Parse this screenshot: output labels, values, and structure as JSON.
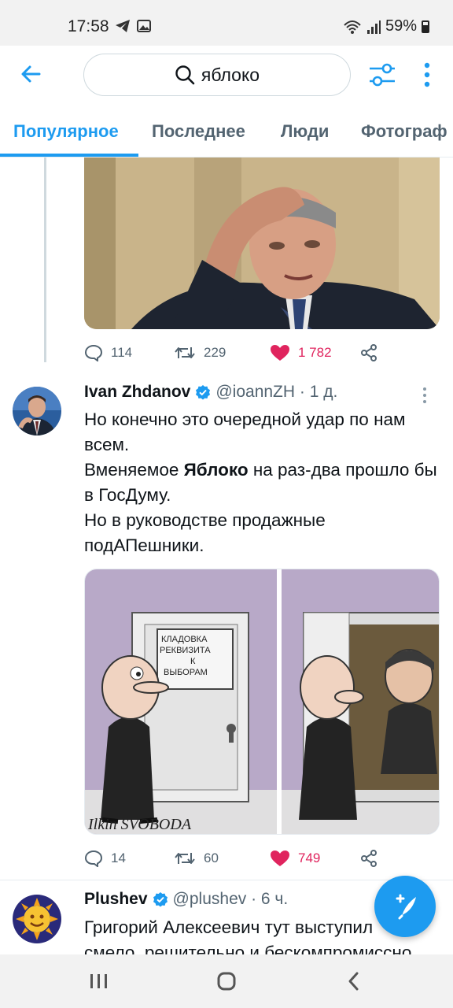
{
  "status_bar": {
    "time": "17:58",
    "battery": "59%"
  },
  "header": {
    "search_value": "яблоко"
  },
  "tabs": [
    {
      "label": "Популярное",
      "active": true
    },
    {
      "label": "Последнее"
    },
    {
      "label": "Люди"
    },
    {
      "label": "Фотограф"
    }
  ],
  "tweet1": {
    "replies": "114",
    "retweets": "229",
    "likes": "1 782"
  },
  "tweet2": {
    "name": "Ivan Zhdanov",
    "meta": "@ioannZH · 1 д.",
    "line1": "Но конечно это очередной удар по нам всем.",
    "line2_pre": "Вменяемое ",
    "line2_bold": "Яблоко",
    "line2_post": " на раз-два прошло бы в ГосДуму.",
    "line3": "Но в руководстве продажные подАПешники.",
    "cartoon_sign": [
      "КЛАДОВКА",
      "РЕКВИЗИТА",
      "К",
      "ВЫБОРАМ"
    ],
    "cartoon_signature": "Ilkin SVOBODA",
    "replies": "14",
    "retweets": "60",
    "likes": "749"
  },
  "tweet3": {
    "name": "Plushev",
    "meta": "@plushev · 6 ч.",
    "line1": "Григорий Алексеевич тут выступил",
    "line2": "смело, решительно и бескомпромиссно"
  },
  "colors": {
    "accent": "#1d9bf0",
    "like": "#e0245e",
    "muted": "#536471"
  },
  "icons": [
    "back-arrow-icon",
    "search-icon",
    "filter-icon",
    "more-vertical-icon",
    "reply-icon",
    "retweet-icon",
    "heart-icon",
    "share-icon",
    "verified-icon",
    "compose-icon"
  ]
}
